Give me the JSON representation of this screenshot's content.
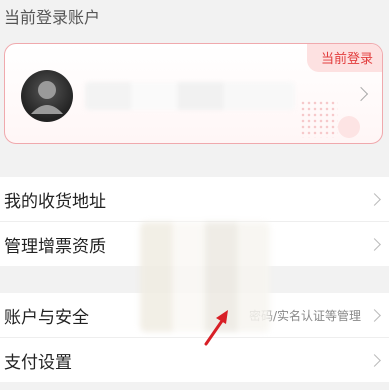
{
  "section_title": "当前登录账户",
  "account_card": {
    "badge": "当前登录"
  },
  "menu_group_1": [
    {
      "label": "我的收货地址",
      "sub": ""
    },
    {
      "label": "管理增票资质",
      "sub": ""
    }
  ],
  "menu_group_2": [
    {
      "label": "账户与安全",
      "sub": "密码/实名认证等管理"
    },
    {
      "label": "支付设置",
      "sub": ""
    }
  ],
  "colors": {
    "accent": "#e23d3d",
    "card_border": "#f0a9ad",
    "badge_bg": "#fde1e1",
    "arrow": "#d81f26"
  }
}
